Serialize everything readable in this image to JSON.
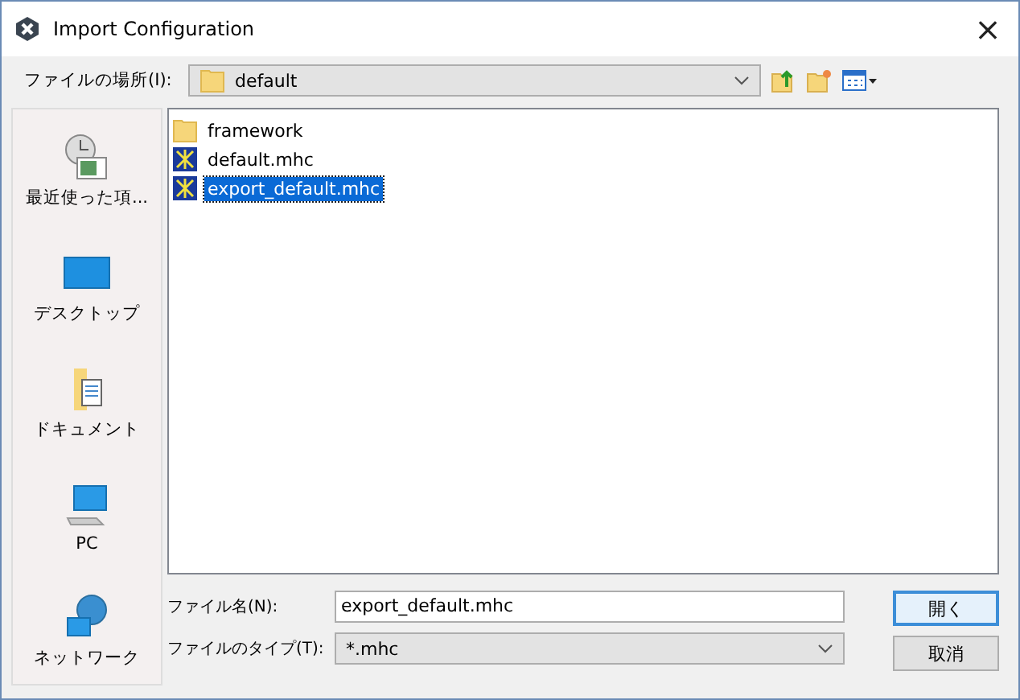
{
  "window": {
    "title": "Import Configuration",
    "close": "×"
  },
  "location": {
    "label": "ファイルの場所(I):",
    "value": "default"
  },
  "places": [
    {
      "label": "最近使った項...",
      "kind": "recent"
    },
    {
      "label": "デスクトップ",
      "kind": "desktop"
    },
    {
      "label": "ドキュメント",
      "kind": "documents"
    },
    {
      "label": "PC",
      "kind": "pc"
    },
    {
      "label": "ネットワーク",
      "kind": "network"
    }
  ],
  "files": [
    {
      "name": "framework",
      "kind": "folder",
      "selected": false
    },
    {
      "name": "default.mhc",
      "kind": "mhc",
      "selected": false
    },
    {
      "name": "export_default.mhc",
      "kind": "mhc",
      "selected": true
    }
  ],
  "filename": {
    "label": "ファイル名(N):",
    "value": "export_default.mhc"
  },
  "filetype": {
    "label": "ファイルのタイプ(T):",
    "value": "*.mhc"
  },
  "buttons": [
    "開く",
    "取消"
  ]
}
